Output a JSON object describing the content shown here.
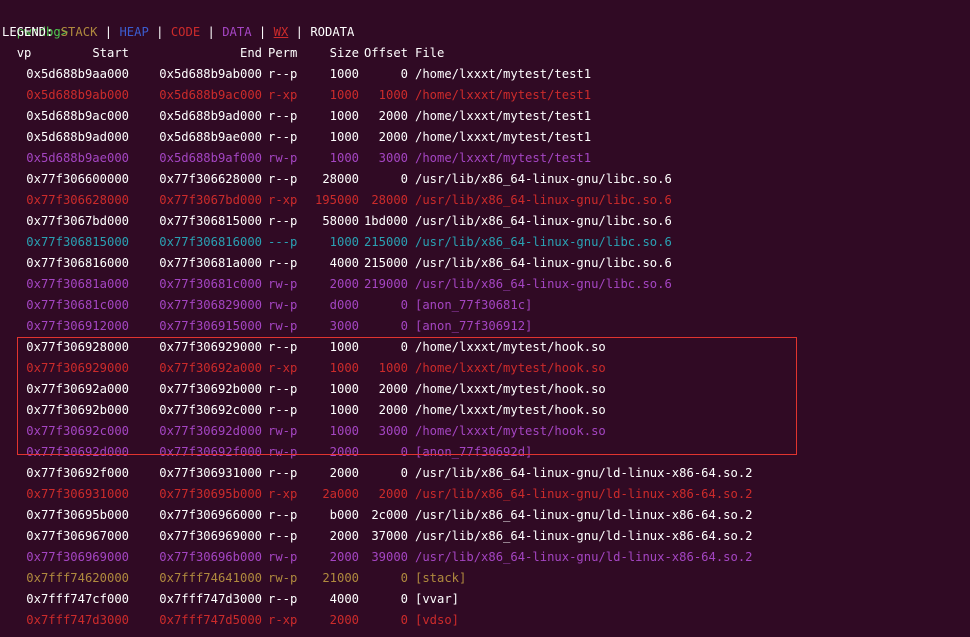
{
  "prompt": {
    "name": "pwndbg>",
    "command": "vp"
  },
  "legend": {
    "label": "LEGEND:",
    "items": [
      {
        "text": "STACK",
        "color": "#b08a3e"
      },
      {
        "text": "HEAP",
        "color": "#3b5ccf"
      },
      {
        "text": "CODE",
        "color": "#cc2b2b"
      },
      {
        "text": "DATA",
        "color": "#a445c2"
      },
      {
        "text": "WX",
        "color": "#cc2b2b"
      },
      {
        "text": "RODATA",
        "color": "#ffffff"
      }
    ],
    "separator": "|"
  },
  "table": {
    "headers": {
      "start": "Start",
      "end": "End",
      "perm": "Perm",
      "size": "Size",
      "offset": "Offset",
      "file": "File"
    },
    "rows": [
      {
        "start": "0x5d688b9aa000",
        "end": "0x5d688b9ab000",
        "perm": "r--p",
        "size": "1000",
        "offset": "0",
        "file": "/home/lxxxt/mytest/test1",
        "color": "#ffffff"
      },
      {
        "start": "0x5d688b9ab000",
        "end": "0x5d688b9ac000",
        "perm": "r-xp",
        "size": "1000",
        "offset": "1000",
        "file": "/home/lxxxt/mytest/test1",
        "color": "#cc2b2b"
      },
      {
        "start": "0x5d688b9ac000",
        "end": "0x5d688b9ad000",
        "perm": "r--p",
        "size": "1000",
        "offset": "2000",
        "file": "/home/lxxxt/mytest/test1",
        "color": "#ffffff"
      },
      {
        "start": "0x5d688b9ad000",
        "end": "0x5d688b9ae000",
        "perm": "r--p",
        "size": "1000",
        "offset": "2000",
        "file": "/home/lxxxt/mytest/test1",
        "color": "#ffffff"
      },
      {
        "start": "0x5d688b9ae000",
        "end": "0x5d688b9af000",
        "perm": "rw-p",
        "size": "1000",
        "offset": "3000",
        "file": "/home/lxxxt/mytest/test1",
        "color": "#a445c2"
      },
      {
        "start": "0x77f306600000",
        "end": "0x77f306628000",
        "perm": "r--p",
        "size": "28000",
        "offset": "0",
        "file": "/usr/lib/x86_64-linux-gnu/libc.so.6",
        "color": "#ffffff"
      },
      {
        "start": "0x77f306628000",
        "end": "0x77f3067bd000",
        "perm": "r-xp",
        "size": "195000",
        "offset": "28000",
        "file": "/usr/lib/x86_64-linux-gnu/libc.so.6",
        "color": "#cc2b2b"
      },
      {
        "start": "0x77f3067bd000",
        "end": "0x77f306815000",
        "perm": "r--p",
        "size": "58000",
        "offset": "1bd000",
        "file": "/usr/lib/x86_64-linux-gnu/libc.so.6",
        "color": "#ffffff"
      },
      {
        "start": "0x77f306815000",
        "end": "0x77f306816000",
        "perm": "---p",
        "size": "1000",
        "offset": "215000",
        "file": "/usr/lib/x86_64-linux-gnu/libc.so.6",
        "color": "#2aa1b3"
      },
      {
        "start": "0x77f306816000",
        "end": "0x77f30681a000",
        "perm": "r--p",
        "size": "4000",
        "offset": "215000",
        "file": "/usr/lib/x86_64-linux-gnu/libc.so.6",
        "color": "#ffffff"
      },
      {
        "start": "0x77f30681a000",
        "end": "0x77f30681c000",
        "perm": "rw-p",
        "size": "2000",
        "offset": "219000",
        "file": "/usr/lib/x86_64-linux-gnu/libc.so.6",
        "color": "#a445c2"
      },
      {
        "start": "0x77f30681c000",
        "end": "0x77f306829000",
        "perm": "rw-p",
        "size": "d000",
        "offset": "0",
        "file": "[anon_77f30681c]",
        "color": "#a445c2"
      },
      {
        "start": "0x77f306912000",
        "end": "0x77f306915000",
        "perm": "rw-p",
        "size": "3000",
        "offset": "0",
        "file": "[anon_77f306912]",
        "color": "#a445c2"
      },
      {
        "start": "0x77f306928000",
        "end": "0x77f306929000",
        "perm": "r--p",
        "size": "1000",
        "offset": "0",
        "file": "/home/lxxxt/mytest/hook.so",
        "color": "#ffffff"
      },
      {
        "start": "0x77f306929000",
        "end": "0x77f30692a000",
        "perm": "r-xp",
        "size": "1000",
        "offset": "1000",
        "file": "/home/lxxxt/mytest/hook.so",
        "color": "#cc2b2b"
      },
      {
        "start": "0x77f30692a000",
        "end": "0x77f30692b000",
        "perm": "r--p",
        "size": "1000",
        "offset": "2000",
        "file": "/home/lxxxt/mytest/hook.so",
        "color": "#ffffff"
      },
      {
        "start": "0x77f30692b000",
        "end": "0x77f30692c000",
        "perm": "r--p",
        "size": "1000",
        "offset": "2000",
        "file": "/home/lxxxt/mytest/hook.so",
        "color": "#ffffff"
      },
      {
        "start": "0x77f30692c000",
        "end": "0x77f30692d000",
        "perm": "rw-p",
        "size": "1000",
        "offset": "3000",
        "file": "/home/lxxxt/mytest/hook.so",
        "color": "#a445c2"
      },
      {
        "start": "0x77f30692d000",
        "end": "0x77f30692f000",
        "perm": "rw-p",
        "size": "2000",
        "offset": "0",
        "file": "[anon_77f30692d]",
        "color": "#a445c2"
      },
      {
        "start": "0x77f30692f000",
        "end": "0x77f306931000",
        "perm": "r--p",
        "size": "2000",
        "offset": "0",
        "file": "/usr/lib/x86_64-linux-gnu/ld-linux-x86-64.so.2",
        "color": "#ffffff"
      },
      {
        "start": "0x77f306931000",
        "end": "0x77f30695b000",
        "perm": "r-xp",
        "size": "2a000",
        "offset": "2000",
        "file": "/usr/lib/x86_64-linux-gnu/ld-linux-x86-64.so.2",
        "color": "#cc2b2b"
      },
      {
        "start": "0x77f30695b000",
        "end": "0x77f306966000",
        "perm": "r--p",
        "size": "b000",
        "offset": "2c000",
        "file": "/usr/lib/x86_64-linux-gnu/ld-linux-x86-64.so.2",
        "color": "#ffffff"
      },
      {
        "start": "0x77f306967000",
        "end": "0x77f306969000",
        "perm": "r--p",
        "size": "2000",
        "offset": "37000",
        "file": "/usr/lib/x86_64-linux-gnu/ld-linux-x86-64.so.2",
        "color": "#ffffff"
      },
      {
        "start": "0x77f306969000",
        "end": "0x77f30696b000",
        "perm": "rw-p",
        "size": "2000",
        "offset": "39000",
        "file": "/usr/lib/x86_64-linux-gnu/ld-linux-x86-64.so.2",
        "color": "#a445c2"
      },
      {
        "start": "0x7fff74620000",
        "end": "0x7fff74641000",
        "perm": "rw-p",
        "size": "21000",
        "offset": "0",
        "file": "[stack]",
        "color": "#b08a3e"
      },
      {
        "start": "0x7fff747cf000",
        "end": "0x7fff747d3000",
        "perm": "r--p",
        "size": "4000",
        "offset": "0",
        "file": "[vvar]",
        "color": "#ffffff"
      },
      {
        "start": "0x7fff747d3000",
        "end": "0x7fff747d5000",
        "perm": "r-xp",
        "size": "2000",
        "offset": "0",
        "file": "[vdso]",
        "color": "#cc2b2b"
      }
    ]
  },
  "highlight": {
    "color": "#e0342f"
  }
}
